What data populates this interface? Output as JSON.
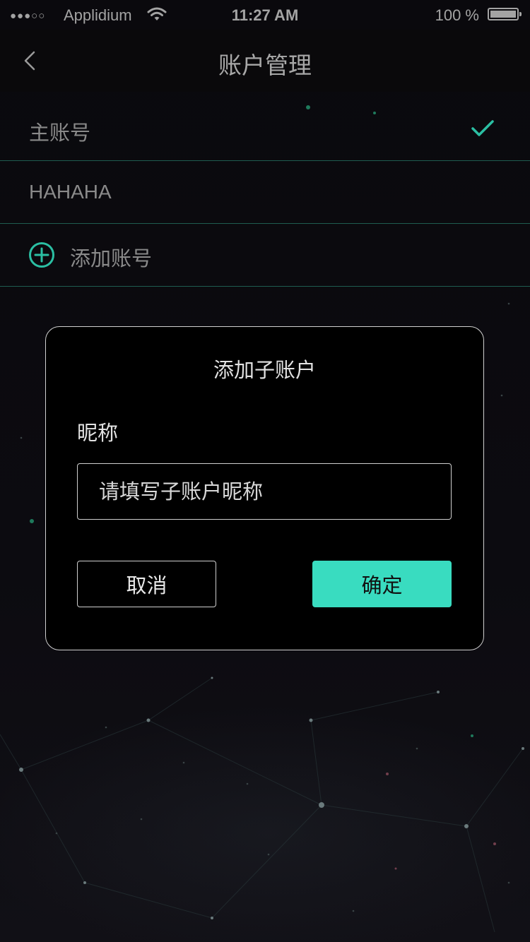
{
  "status_bar": {
    "signal": "●●●○○",
    "carrier": "Applidium",
    "time": "11:27 AM",
    "battery_percent": "100 %",
    "battery_level": 1.0
  },
  "nav": {
    "title": "账户管理",
    "back_icon": "chevron-left-icon"
  },
  "accounts": {
    "items": [
      {
        "label": "主账号",
        "selected": true
      },
      {
        "label": "HAHAHA",
        "selected": false
      }
    ],
    "add_label": "添加账号",
    "add_icon": "plus-circle-icon",
    "check_icon": "checkmark-icon"
  },
  "dialog": {
    "title": "添加子账户",
    "field_label": "昵称",
    "input_value": "",
    "input_placeholder": "请填写子账户昵称",
    "cancel_label": "取消",
    "confirm_label": "确定"
  },
  "colors": {
    "accent": "#39dcc0",
    "divider": "#1f5c50",
    "background": "#0b0a0e",
    "dialog_background": "#000000"
  }
}
